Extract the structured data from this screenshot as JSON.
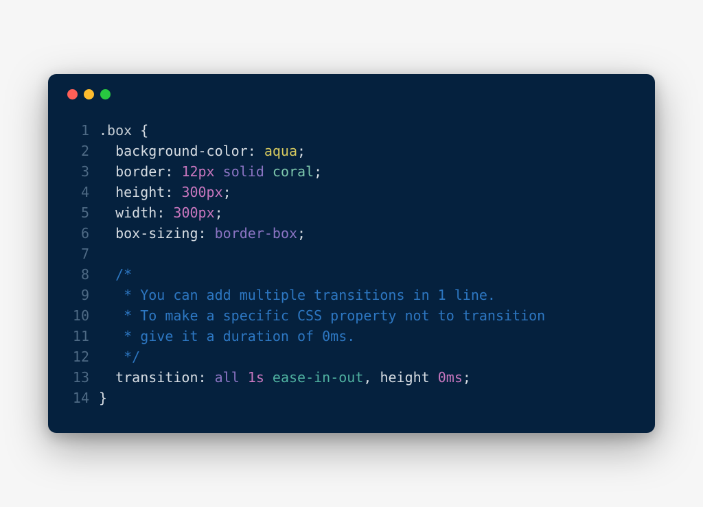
{
  "window": {
    "kind": "macos-style"
  },
  "code": {
    "language": "css",
    "lines": [
      {
        "n": 1,
        "tokens": [
          {
            "t": ".box",
            "c": "tok-selector"
          },
          {
            "t": " {",
            "c": "tok-punct"
          }
        ]
      },
      {
        "n": 2,
        "tokens": [
          {
            "t": "  ",
            "c": "tok-default"
          },
          {
            "t": "background-color",
            "c": "tok-property"
          },
          {
            "t": ": ",
            "c": "tok-punct"
          },
          {
            "t": "aqua",
            "c": "tok-value1"
          },
          {
            "t": ";",
            "c": "tok-punct"
          }
        ]
      },
      {
        "n": 3,
        "tokens": [
          {
            "t": "  ",
            "c": "tok-default"
          },
          {
            "t": "border",
            "c": "tok-property"
          },
          {
            "t": ": ",
            "c": "tok-punct"
          },
          {
            "t": "12px",
            "c": "tok-number"
          },
          {
            "t": " ",
            "c": "tok-default"
          },
          {
            "t": "solid",
            "c": "tok-keyword"
          },
          {
            "t": " ",
            "c": "tok-default"
          },
          {
            "t": "coral",
            "c": "tok-value2"
          },
          {
            "t": ";",
            "c": "tok-punct"
          }
        ]
      },
      {
        "n": 4,
        "tokens": [
          {
            "t": "  ",
            "c": "tok-default"
          },
          {
            "t": "height",
            "c": "tok-property"
          },
          {
            "t": ": ",
            "c": "tok-punct"
          },
          {
            "t": "300px",
            "c": "tok-number"
          },
          {
            "t": ";",
            "c": "tok-punct"
          }
        ]
      },
      {
        "n": 5,
        "tokens": [
          {
            "t": "  ",
            "c": "tok-default"
          },
          {
            "t": "width",
            "c": "tok-property"
          },
          {
            "t": ": ",
            "c": "tok-punct"
          },
          {
            "t": "300px",
            "c": "tok-number"
          },
          {
            "t": ";",
            "c": "tok-punct"
          }
        ]
      },
      {
        "n": 6,
        "tokens": [
          {
            "t": "  ",
            "c": "tok-default"
          },
          {
            "t": "box-sizing",
            "c": "tok-property"
          },
          {
            "t": ": ",
            "c": "tok-punct"
          },
          {
            "t": "border-box",
            "c": "tok-value3"
          },
          {
            "t": ";",
            "c": "tok-punct"
          }
        ]
      },
      {
        "n": 7,
        "tokens": [
          {
            "t": " ",
            "c": "tok-default"
          }
        ]
      },
      {
        "n": 8,
        "tokens": [
          {
            "t": "  ",
            "c": "tok-default"
          },
          {
            "t": "/*",
            "c": "tok-comment"
          }
        ]
      },
      {
        "n": 9,
        "tokens": [
          {
            "t": "   * You can add multiple transitions in 1 line.",
            "c": "tok-comment"
          }
        ]
      },
      {
        "n": 10,
        "tokens": [
          {
            "t": "   * To make a specific CSS property not to transition",
            "c": "tok-comment"
          }
        ]
      },
      {
        "n": 11,
        "tokens": [
          {
            "t": "   * give it a duration of 0ms.",
            "c": "tok-comment"
          }
        ]
      },
      {
        "n": 12,
        "tokens": [
          {
            "t": "   */",
            "c": "tok-comment"
          }
        ]
      },
      {
        "n": 13,
        "tokens": [
          {
            "t": "  ",
            "c": "tok-default"
          },
          {
            "t": "transition",
            "c": "tok-property"
          },
          {
            "t": ": ",
            "c": "tok-punct"
          },
          {
            "t": "all",
            "c": "tok-keyword"
          },
          {
            "t": " ",
            "c": "tok-default"
          },
          {
            "t": "1s",
            "c": "tok-number"
          },
          {
            "t": " ",
            "c": "tok-default"
          },
          {
            "t": "ease-in-out",
            "c": "tok-value4"
          },
          {
            "t": ", ",
            "c": "tok-punct"
          },
          {
            "t": "height",
            "c": "tok-property"
          },
          {
            "t": " ",
            "c": "tok-default"
          },
          {
            "t": "0ms",
            "c": "tok-number"
          },
          {
            "t": ";",
            "c": "tok-punct"
          }
        ]
      },
      {
        "n": 14,
        "tokens": [
          {
            "t": "}",
            "c": "tok-punct"
          }
        ]
      }
    ]
  }
}
